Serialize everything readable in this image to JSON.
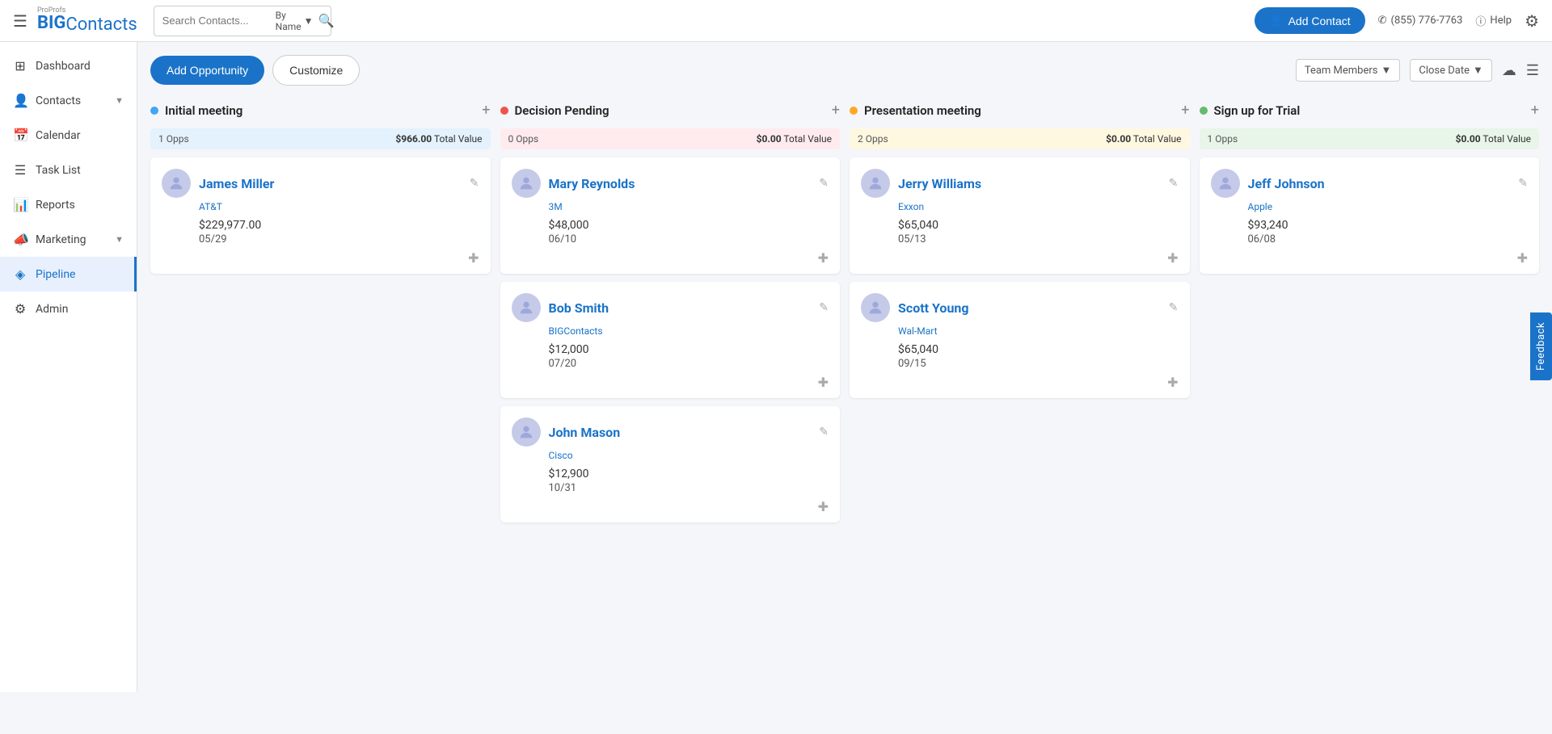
{
  "topnav": {
    "logo_pro": "ProProfs",
    "logo_big": "BIG",
    "logo_contacts": "Contacts",
    "search_placeholder": "Search Contacts...",
    "search_by": "By Name",
    "add_contact_label": "Add Contact",
    "phone": "(855) 776-7763",
    "help": "Help"
  },
  "sidebar": {
    "items": [
      {
        "id": "dashboard",
        "label": "Dashboard",
        "icon": "⊞",
        "active": false
      },
      {
        "id": "contacts",
        "label": "Contacts",
        "icon": "👤",
        "active": false,
        "has_chevron": true
      },
      {
        "id": "calendar",
        "label": "Calendar",
        "icon": "📅",
        "active": false
      },
      {
        "id": "task-list",
        "label": "Task List",
        "icon": "☰",
        "active": false
      },
      {
        "id": "reports",
        "label": "Reports",
        "icon": "📊",
        "active": false
      },
      {
        "id": "marketing",
        "label": "Marketing",
        "icon": "📣",
        "active": false,
        "has_chevron": true
      },
      {
        "id": "pipeline",
        "label": "Pipeline",
        "icon": "◈",
        "active": true
      },
      {
        "id": "admin",
        "label": "Admin",
        "icon": "⚙",
        "active": false
      }
    ]
  },
  "toolbar": {
    "add_opportunity_label": "Add Opportunity",
    "customize_label": "Customize",
    "team_members_label": "Team Members",
    "close_date_label": "Close Date"
  },
  "columns": [
    {
      "id": "initial-meeting",
      "title": "Initial meeting",
      "dot_color": "#42a5f5",
      "stats_bg": "#e3f2fd",
      "opps_count": "1 Opps",
      "total_value_prefix": "$966.00",
      "total_value_suffix": "Total Value",
      "cards": [
        {
          "name": "James Miller",
          "company": "AT&T",
          "amount": "$229,977.00",
          "date": "05/29"
        }
      ]
    },
    {
      "id": "decision-pending",
      "title": "Decision Pending",
      "dot_color": "#ef5350",
      "stats_bg": "#ffebee",
      "opps_count": "0 Opps",
      "total_value_prefix": "$0.00",
      "total_value_suffix": "Total Value",
      "cards": [
        {
          "name": "Mary Reynolds",
          "company": "3M",
          "amount": "$48,000",
          "date": "06/10"
        },
        {
          "name": "Bob Smith",
          "company": "BIGContacts",
          "amount": "$12,000",
          "date": "07/20"
        },
        {
          "name": "John Mason",
          "company": "Cisco",
          "amount": "$12,900",
          "date": "10/31"
        }
      ]
    },
    {
      "id": "presentation-meeting",
      "title": "Presentation meeting",
      "dot_color": "#ffa726",
      "stats_bg": "#fff8e1",
      "opps_count": "2 Opps",
      "total_value_prefix": "$0.00",
      "total_value_suffix": "Total Value",
      "cards": [
        {
          "name": "Jerry Williams",
          "company": "Exxon",
          "amount": "$65,040",
          "date": "05/13"
        },
        {
          "name": "Scott Young",
          "company": "Wal-Mart",
          "amount": "$65,040",
          "date": "09/15"
        }
      ]
    },
    {
      "id": "sign-up-trial",
      "title": "Sign up for Trial",
      "dot_color": "#66bb6a",
      "stats_bg": "#e8f5e9",
      "opps_count": "1 Opps",
      "total_value_prefix": "$0.00",
      "total_value_suffix": "Total Value",
      "cards": [
        {
          "name": "Jeff Johnson",
          "company": "Apple",
          "amount": "$93,240",
          "date": "06/08"
        }
      ]
    }
  ],
  "feedback": "Feedback"
}
